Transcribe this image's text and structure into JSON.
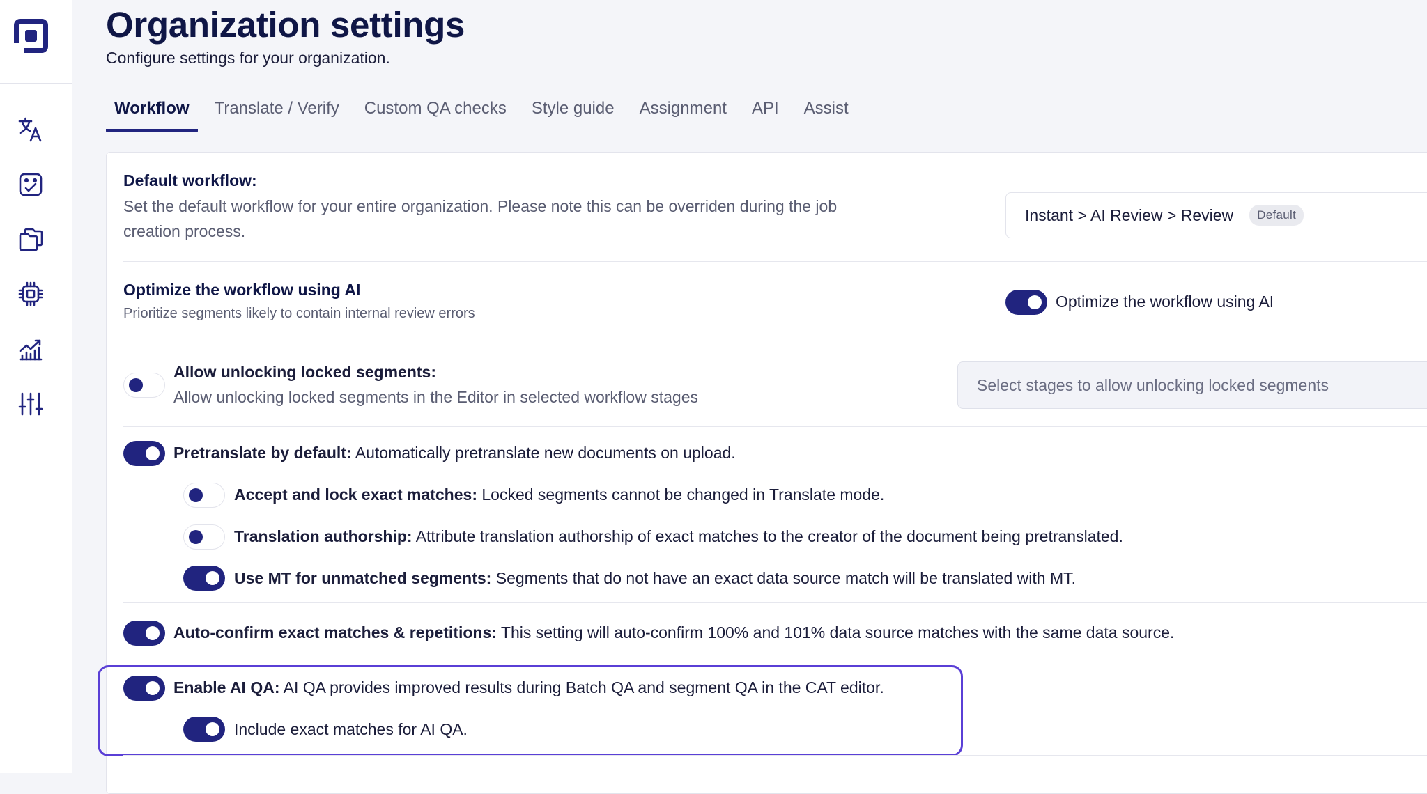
{
  "page": {
    "title": "Organization settings",
    "subtitle": "Configure settings for your organization."
  },
  "sidebar": {
    "logo": "app-logo",
    "items": [
      {
        "icon": "translate-icon"
      },
      {
        "icon": "review-icon"
      },
      {
        "icon": "documents-icon"
      },
      {
        "icon": "chip-icon"
      },
      {
        "icon": "analytics-icon"
      },
      {
        "icon": "sliders-icon"
      }
    ]
  },
  "tabs": [
    {
      "label": "Workflow",
      "active": true
    },
    {
      "label": "Translate / Verify",
      "active": false
    },
    {
      "label": "Custom QA checks",
      "active": false
    },
    {
      "label": "Style guide",
      "active": false
    },
    {
      "label": "Assignment",
      "active": false
    },
    {
      "label": "API",
      "active": false
    },
    {
      "label": "Assist",
      "active": false
    }
  ],
  "default_workflow": {
    "title": "Default workflow:",
    "description": "Set the default workflow for your entire organization. Please note this can be overriden during the job creation process.",
    "selected": "Instant > AI Review > Review",
    "badge": "Default"
  },
  "optimize": {
    "title": "Optimize the workflow using AI",
    "description": "Prioritize segments likely to contain internal review errors",
    "toggle_label": "Optimize the workflow using AI",
    "enabled": true
  },
  "unlock": {
    "title": "Allow unlocking locked segments:",
    "description": "Allow unlocking locked segments in the Editor in selected workflow stages",
    "placeholder": "Select stages to allow unlocking locked segments",
    "enabled": false
  },
  "pretranslate": {
    "title": "Pretranslate by default:",
    "description": " Automatically pretranslate new documents on upload.",
    "enabled": true,
    "sub_options": [
      {
        "title": "Accept and lock exact matches:",
        "description": " Locked segments cannot be changed in Translate mode.",
        "enabled": false
      },
      {
        "title": "Translation authorship:",
        "description": " Attribute translation authorship of exact matches to the creator of the document being pretranslated.",
        "enabled": false
      },
      {
        "title": "Use MT for unmatched segments:",
        "description": " Segments that do not have an exact data source match will be translated with MT.",
        "enabled": true
      }
    ]
  },
  "auto_confirm": {
    "title": "Auto-confirm exact matches & repetitions:",
    "description": " This setting will auto-confirm 100% and 101% data source matches with the same data source.",
    "enabled": true
  },
  "ai_qa": {
    "title": "Enable AI QA:",
    "description": " AI QA provides improved results during Batch QA and segment QA in the CAT editor.",
    "enabled": true,
    "sub_label": "Include exact matches for AI QA.",
    "sub_enabled": true
  },
  "colors": {
    "brand": "#21247f",
    "highlight": "#5a3fd6"
  }
}
